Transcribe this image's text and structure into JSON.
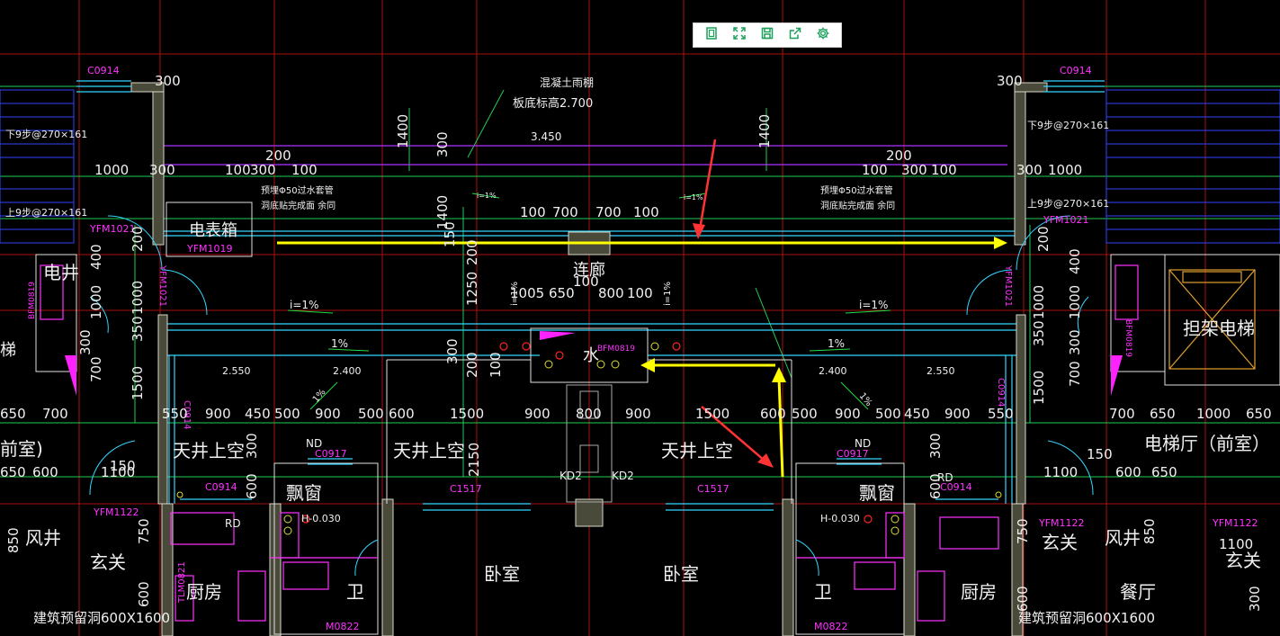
{
  "toolbar": {
    "buttons": [
      {
        "icon": "frame-icon"
      },
      {
        "icon": "fullscreen-icon"
      },
      {
        "icon": "save-icon"
      },
      {
        "icon": "share-icon"
      },
      {
        "icon": "gear-icon"
      }
    ],
    "icon_color": "#1aa05a"
  },
  "colors": {
    "background": "#000000",
    "dim_green": "#33ff66",
    "wall": "#c8c8c8",
    "magenta": "#ff33ff",
    "cyan": "#33e6ff",
    "blue": "#3333ff",
    "red": "#ff2222",
    "yellow": "#ffff00",
    "arrow_red": "#ff3333"
  },
  "labels": {
    "c0914_l": "C0914",
    "c0914_r": "C0914",
    "d300_tl": "300",
    "d300_tr": "300",
    "canopy1": "混凝土雨棚",
    "canopy2": "板底标高2.700",
    "elev_3450": "3.450",
    "d1400_l": "1400",
    "d300_mid": "300",
    "d1400_r": "1400",
    "stair_down_l": "下9步@270×161",
    "stair_down_r": "下9步@270×161",
    "d200_l": "200",
    "d200_r": "200",
    "d1000_l": "1000",
    "d300_l2": "300",
    "d100_l": "100",
    "d300_l3": "300",
    "d100_l2": "100",
    "d100_r": "100",
    "d300_r2": "300",
    "d100_r2": "100",
    "d300_r3": "300",
    "d1000_r": "1000",
    "sleeve_l1": "预埋Φ50过水套管",
    "sleeve_l2": "洞底贴完成面 余同",
    "sleeve_r1": "预埋Φ50过水套管",
    "sleeve_r2": "洞底贴完成面 余同",
    "slope_1pct_a": "i=1%",
    "slope_1pct_b": "i=1%",
    "stair_up_l": "上9步@270×161",
    "stair_up_r": "上9步@270×161",
    "yfm1021_l": "YFM1021",
    "yfm1021_r": "YFM1021",
    "meter_box": "电表箱",
    "yfm1019": "YFM1019",
    "d1400_m": "1400",
    "d150_m": "150",
    "d200_m": "200",
    "d100_a": "100",
    "d700_a": "700",
    "d700_b": "700",
    "d100_b": "100",
    "corridor": "连廊",
    "d_1005": "1005",
    "d_650": "650",
    "d_100": "100",
    "d_800": "800",
    "d_100b": "100",
    "d1250": "1250",
    "slope_l": "i=1%",
    "slope_r": "i=1%",
    "elec_shaft": "电井",
    "bfm_l": "BFM0819",
    "yfm_v_l": "YFM1021",
    "yfm_v_r": "YFM1021",
    "d400": "400",
    "d1000v": "1000",
    "d350": "350",
    "d300v": "300",
    "d700v": "700",
    "d1500v": "1500",
    "d400_r": "400",
    "d1000v_r": "1000",
    "d350_r": "350",
    "d300v_r": "300",
    "d700v_r": "700",
    "d1500v_r": "1500",
    "elevator": "担架电梯",
    "pct_l": "1%",
    "pct_r": "1%",
    "water": "水",
    "bfm_water": "BFM0819",
    "d300_w": "300",
    "d200_w": "200",
    "d100_w": "100",
    "el_2550_l": "2.550",
    "el_2400_l": "2.400",
    "el_2400_r": "2.400",
    "el_2550_r": "2.550",
    "pct_diag_l": "1%",
    "pct_diag_r": "1%",
    "dims_row": [
      "650",
      "700",
      "550",
      "900",
      "450",
      "500",
      "900",
      "500",
      "600",
      "1500",
      "900",
      "800",
      "900",
      "1500",
      "600",
      "500",
      "900",
      "500",
      "450",
      "900",
      "550",
      "700",
      "650",
      "1000",
      "650"
    ],
    "front_room_l": "前室)",
    "front_room_r": "电梯厅（前室）",
    "d150_l": "150",
    "d150_r": "150",
    "light_well_1": "天井上空",
    "light_well_2": "天井上空",
    "light_well_3": "天井上空",
    "d300_lw": "300",
    "d300_rw": "300",
    "d2150": "2150",
    "nd_l": "ND",
    "nd_r": "ND",
    "c0917_l": "C0917",
    "c0917_r": "C0917",
    "rd_r": "RD",
    "rd_l": "RD",
    "d650_600_l": [
      "650",
      "600",
      "1100"
    ],
    "d1100_r": [
      "1100",
      "600",
      "650"
    ],
    "bay_window_l": "飘窗",
    "bay_window_r": "飘窗",
    "d600_l": "600",
    "d600_r": "600",
    "c0914_bl": "C0914",
    "c0914_br": "C0914",
    "c1517_l": "C1517",
    "c1517_r": "C1517",
    "kd2_l": "KD2",
    "kd2_r": "KD2",
    "yfm1122_l": "YFM1122",
    "yfm1122_r": "YFM1122",
    "yfm1122_r2": "YFM1122",
    "h_l": "H-0.030",
    "h_r": "H-0.030",
    "d850_l": "850",
    "air_shaft_l": "风井",
    "air_shaft_r": "风井",
    "d750_l": "750",
    "d750_r": "750",
    "d850_r": "850",
    "entrance_l": "玄关",
    "entrance_r": "玄关",
    "entrance_r2": "玄关",
    "d1100_r2": "1100",
    "bedroom_l": "卧室",
    "bedroom_r": "卧室",
    "kitchen_l": "厨房",
    "kitchen_r": "厨房",
    "bath_l": "卫",
    "bath_r": "卫",
    "dining": "餐厅",
    "reserve_l": "建筑预留洞600X1600",
    "reserve_r": "建筑预留洞600X1600",
    "d600_bl": "600",
    "d600_br": "600",
    "d300_br": "300",
    "m0822_l": "M0822",
    "m0822_r": "M0822",
    "tlm_l": "TLM0821"
  }
}
